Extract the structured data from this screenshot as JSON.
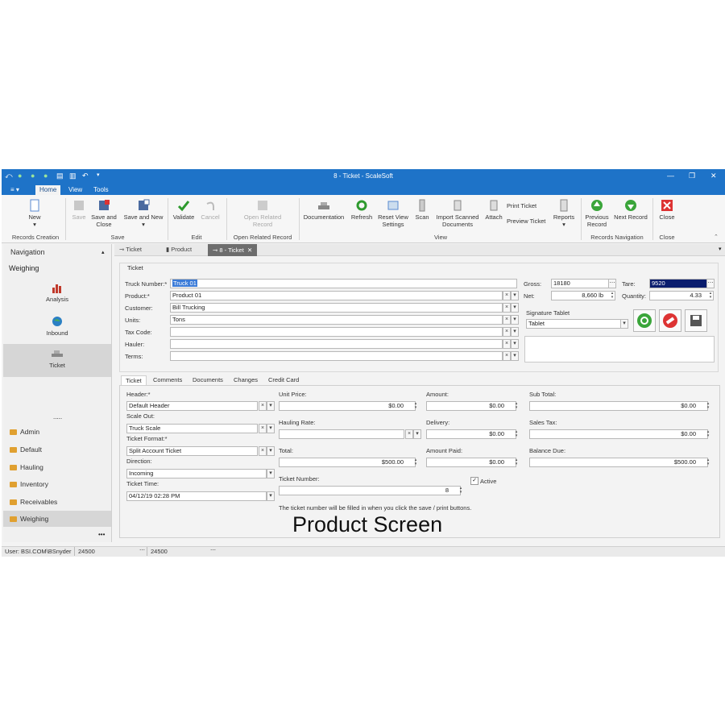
{
  "window": {
    "title": "8 - Ticket - ScaleSoft",
    "menu_tabs": [
      "Home",
      "View",
      "Tools"
    ],
    "app_menu_label": "≡ ▾"
  },
  "ribbon": {
    "buttons": {
      "new": "New",
      "save": "Save",
      "save_close": "Save and Close",
      "save_new": "Save and New",
      "validate": "Validate",
      "cancel": "Cancel",
      "open_related": "Open Related Record",
      "documentation": "Documentation",
      "refresh": "Refresh",
      "reset_view": "Reset View Settings",
      "scan": "Scan",
      "import_scanned": "Import Scanned Documents",
      "attach": "Attach",
      "print_ticket": "Print Ticket",
      "preview_ticket": "Preview Ticket",
      "reports": "Reports",
      "previous_record": "Previous Record",
      "next_record": "Next Record",
      "close": "Close"
    },
    "groups": {
      "records_creation": "Records Creation",
      "save": "Save",
      "edit": "Edit",
      "open_related": "Open Related Record",
      "view": "View",
      "records_navigation": "Records Navigation",
      "close": "Close"
    }
  },
  "navigation": {
    "title": "Navigation",
    "section": "Weighing",
    "items": [
      "Analysis",
      "Inbound",
      "Ticket"
    ],
    "more": ".....",
    "categories": [
      "Admin",
      "Default",
      "Hauling",
      "Inventory",
      "Receivables",
      "Weighing"
    ],
    "overflow": "•••"
  },
  "doc_tabs": [
    "Ticket",
    "Product",
    "8 - Ticket"
  ],
  "ticket": {
    "group_label": "Ticket",
    "truck_number_label": "Truck Number:*",
    "truck_number": "Truck 01",
    "product_label": "Product:*",
    "product": "Product 01",
    "customer_label": "Customer:",
    "customer": "Bill Trucking",
    "units_label": "Units:",
    "units": "Tons",
    "tax_code_label": "Tax Code:",
    "tax_code": "",
    "hauler_label": "Hauler:",
    "hauler": "",
    "terms_label": "Terms:",
    "terms": "",
    "gross_label": "Gross:",
    "gross": "18180",
    "tare_label": "Tare:",
    "tare": "9520",
    "net_label": "Net:",
    "net": "8,660 lb",
    "quantity_label": "Quantity:",
    "quantity": "4.33",
    "signature_label": "Signature Tablet",
    "signature_device": "Tablet"
  },
  "sub_tabs": [
    "Ticket",
    "Comments",
    "Documents",
    "Changes",
    "Credit Card"
  ],
  "details": {
    "header_label": "Header:*",
    "header": "Default Header",
    "scale_out_label": "Scale Out:",
    "scale_out": "Truck Scale",
    "ticket_format_label": "Ticket Format:*",
    "ticket_format": "Split Account Ticket",
    "direction_label": "Direction:",
    "direction": "Incoming",
    "ticket_time_label": "Ticket Time:",
    "ticket_time": "04/12/19 02:28 PM",
    "unit_price_label": "Unit Price:",
    "unit_price": "$0.00",
    "amount_label": "Amount:",
    "amount": "$0.00",
    "sub_total_label": "Sub Total:",
    "sub_total": "$0.00",
    "hauling_rate_label": "Hauling Rate:",
    "hauling_rate": "",
    "delivery_label": "Delivery:",
    "delivery": "$0.00",
    "sales_tax_label": "Sales Tax:",
    "sales_tax": "$0.00",
    "total_label": "Total:",
    "total": "$500.00",
    "amount_paid_label": "Amount Paid:",
    "amount_paid": "$0.00",
    "balance_due_label": "Balance Due:",
    "balance_due": "$500.00",
    "ticket_number_label": "Ticket Number:",
    "ticket_number": "8",
    "active_label": "Active",
    "note": "The ticket number will be filled in when you click the save / print buttons."
  },
  "status": {
    "user": "User: BSI.COM\\BSnyder",
    "field1": "24500",
    "field2": "24500"
  },
  "caption": "Product Screen",
  "colors": {
    "titlebar": "#1e73c8",
    "selection": "#3b7bd8",
    "tare_field": "#0a1d6e"
  }
}
